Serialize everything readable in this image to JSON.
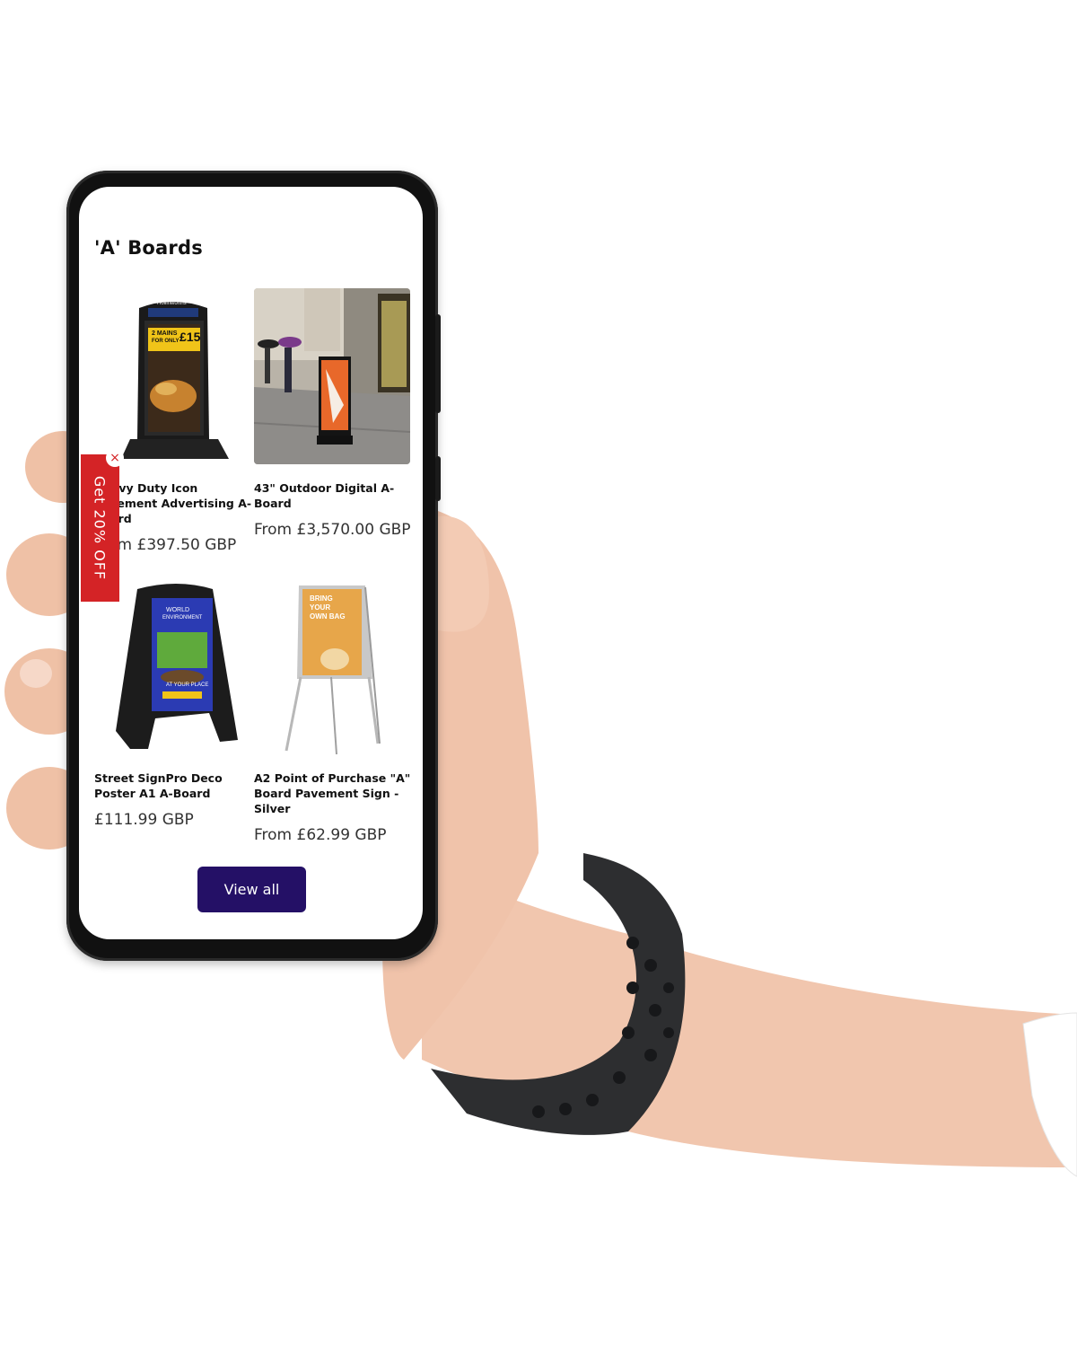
{
  "section": {
    "title": "'A' Boards"
  },
  "products": [
    {
      "name": "Heavy Duty Icon Pavement Advertising A-Board",
      "price": "From £397.50 GBP",
      "image_poster": {
        "brand": "Hollinworths",
        "line1": "2 MAINS",
        "line2": "FOR ONLY",
        "amount": "£15"
      }
    },
    {
      "name": "43\" Outdoor Digital A-Board",
      "price": "From £3,570.00 GBP"
    },
    {
      "name": "Street SignPro Deco Poster A1 A-Board",
      "price": "£111.99 GBP",
      "image_poster": {
        "line1": "WORLD",
        "line2": "ENVIRONMENT",
        "line3": "AT YOUR PLACE"
      }
    },
    {
      "name": "A2 Point of Purchase \"A\" Board Pavement Sign - Silver",
      "price": "From £62.99 GBP",
      "image_poster": {
        "line1": "BRING",
        "line2": "YOUR",
        "line3": "OWN BAG"
      }
    }
  ],
  "view_all_label": "View all",
  "promo": {
    "label": "Get 20% OFF",
    "close_glyph": "×"
  },
  "colors": {
    "button": "#241066",
    "promo": "#d42326"
  }
}
